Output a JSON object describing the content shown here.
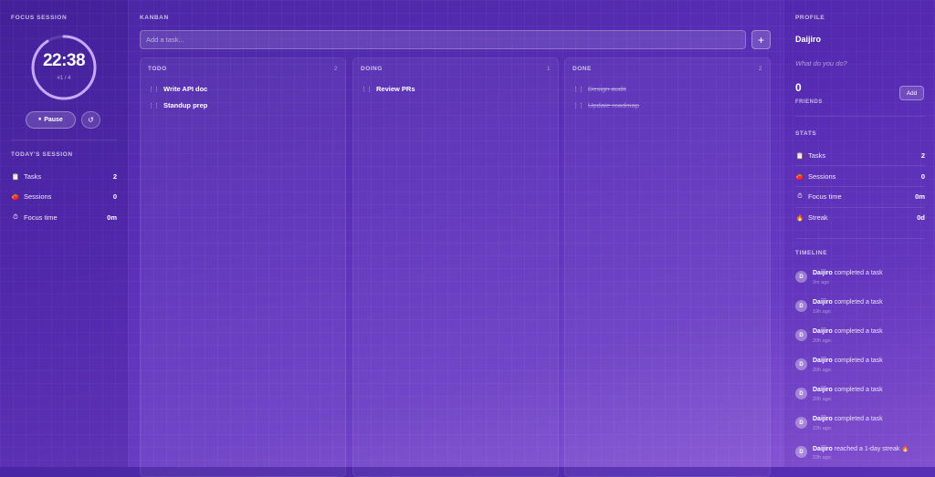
{
  "focus": {
    "title": "FOCUS SESSION",
    "timer": "22:38",
    "round": "#1 / 4",
    "progress": 0.09,
    "pause_label": "Pause",
    "pause_icon": "⏸",
    "reset_icon": "↺"
  },
  "today": {
    "title": "TODAY'S SESSION",
    "rows": [
      {
        "icon": "📋",
        "label": "Tasks",
        "value": "2"
      },
      {
        "icon": "🍅",
        "label": "Sessions",
        "value": "0"
      },
      {
        "icon": "⏱",
        "label": "Focus time",
        "value": "0m"
      }
    ]
  },
  "kanban": {
    "title": "KANBAN",
    "placeholder": "Add a task...",
    "add_icon": "+",
    "columns": [
      {
        "name": "TODO",
        "count": "2",
        "cards": [
          "Write API doc",
          "Standup prep"
        ]
      },
      {
        "name": "DOING",
        "count": "1",
        "cards": [
          "Review PRs"
        ]
      },
      {
        "name": "DONE",
        "count": "2",
        "cards": [
          "Design audit",
          "Update roadmap"
        ]
      }
    ]
  },
  "profile": {
    "title": "PROFILE",
    "name": "Daijiro",
    "prompt": "What do you do?",
    "friends_count": "0",
    "friends_label": "FRIENDS",
    "add_label": "Add"
  },
  "stats": {
    "title": "STATS",
    "rows": [
      {
        "icon": "📋",
        "label": "Tasks",
        "value": "2"
      },
      {
        "icon": "🍅",
        "label": "Sessions",
        "value": "0"
      },
      {
        "icon": "⏱",
        "label": "Focus time",
        "value": "0m"
      },
      {
        "icon": "🔥",
        "label": "Streak",
        "value": "0d"
      }
    ]
  },
  "timeline": {
    "title": "TIMELINE",
    "items": [
      {
        "avatar": "D",
        "user": "Daijiro",
        "action": "completed a task",
        "time": "2m ago"
      },
      {
        "avatar": "D",
        "user": "Daijiro",
        "action": "completed a task",
        "time": "19h ago"
      },
      {
        "avatar": "D",
        "user": "Daijiro",
        "action": "completed a task",
        "time": "20h ago"
      },
      {
        "avatar": "D",
        "user": "Daijiro",
        "action": "completed a task",
        "time": "20h ago"
      },
      {
        "avatar": "D",
        "user": "Daijiro",
        "action": "completed a task",
        "time": "20h ago"
      },
      {
        "avatar": "D",
        "user": "Daijiro",
        "action": "completed a task",
        "time": "22h ago"
      },
      {
        "avatar": "D",
        "user": "Daijiro",
        "action": "reached a 1-day streak 🔥",
        "time": "23h ago"
      }
    ]
  }
}
